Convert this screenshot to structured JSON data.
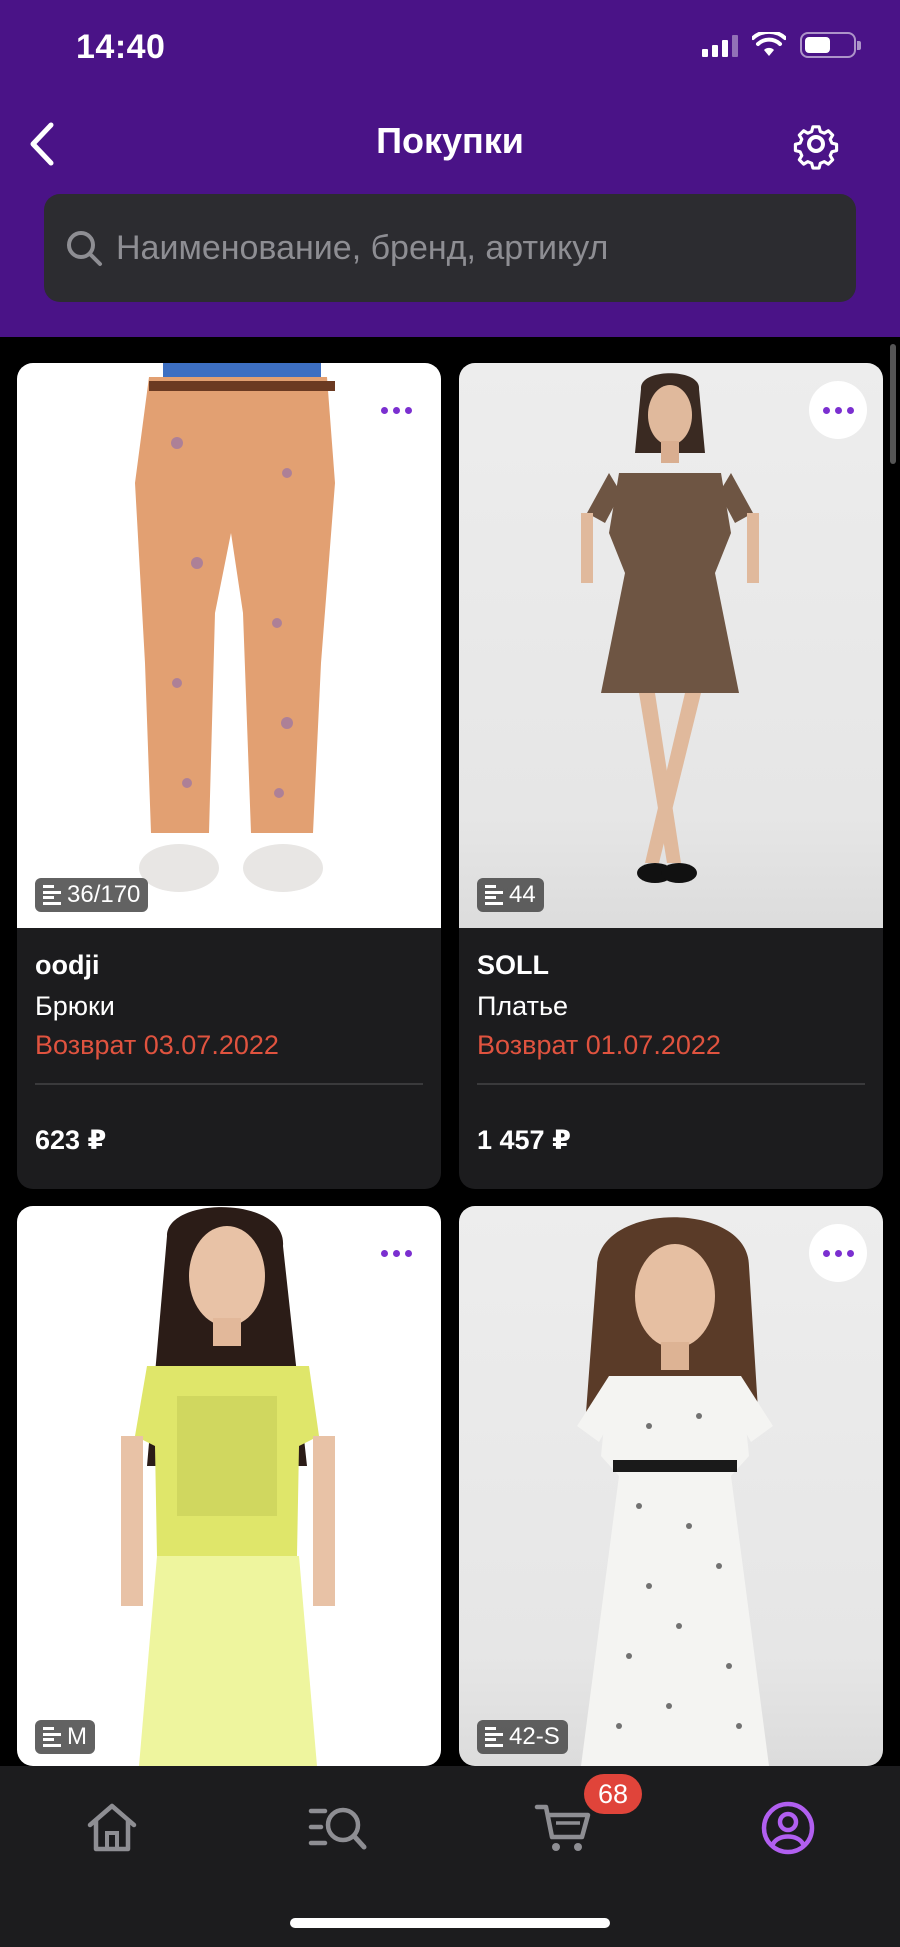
{
  "status_bar": {
    "time": "14:40"
  },
  "header": {
    "title": "Покупки"
  },
  "search": {
    "placeholder": "Наименование, бренд, артикул"
  },
  "products": [
    {
      "brand": "oodji",
      "name": "Брюки",
      "return_text": "Возврат 03.07.2022",
      "price": "623 ₽",
      "size": "36/170"
    },
    {
      "brand": "SOLL",
      "name": "Платье",
      "return_text": "Возврат 01.07.2022",
      "price": "1 457 ₽",
      "size": "44"
    },
    {
      "brand": "",
      "name": "",
      "return_text": "",
      "price": "",
      "size": "M"
    },
    {
      "brand": "",
      "name": "",
      "return_text": "",
      "price": "",
      "size": "42-S"
    }
  ],
  "tabbar": {
    "cart_count": "68",
    "active_tab": "profile"
  },
  "colors": {
    "header": "#4a1387",
    "accent": "#7b2fd0",
    "return": "#e0533f",
    "badge": "#e0443a",
    "card": "#1c1c1e"
  }
}
